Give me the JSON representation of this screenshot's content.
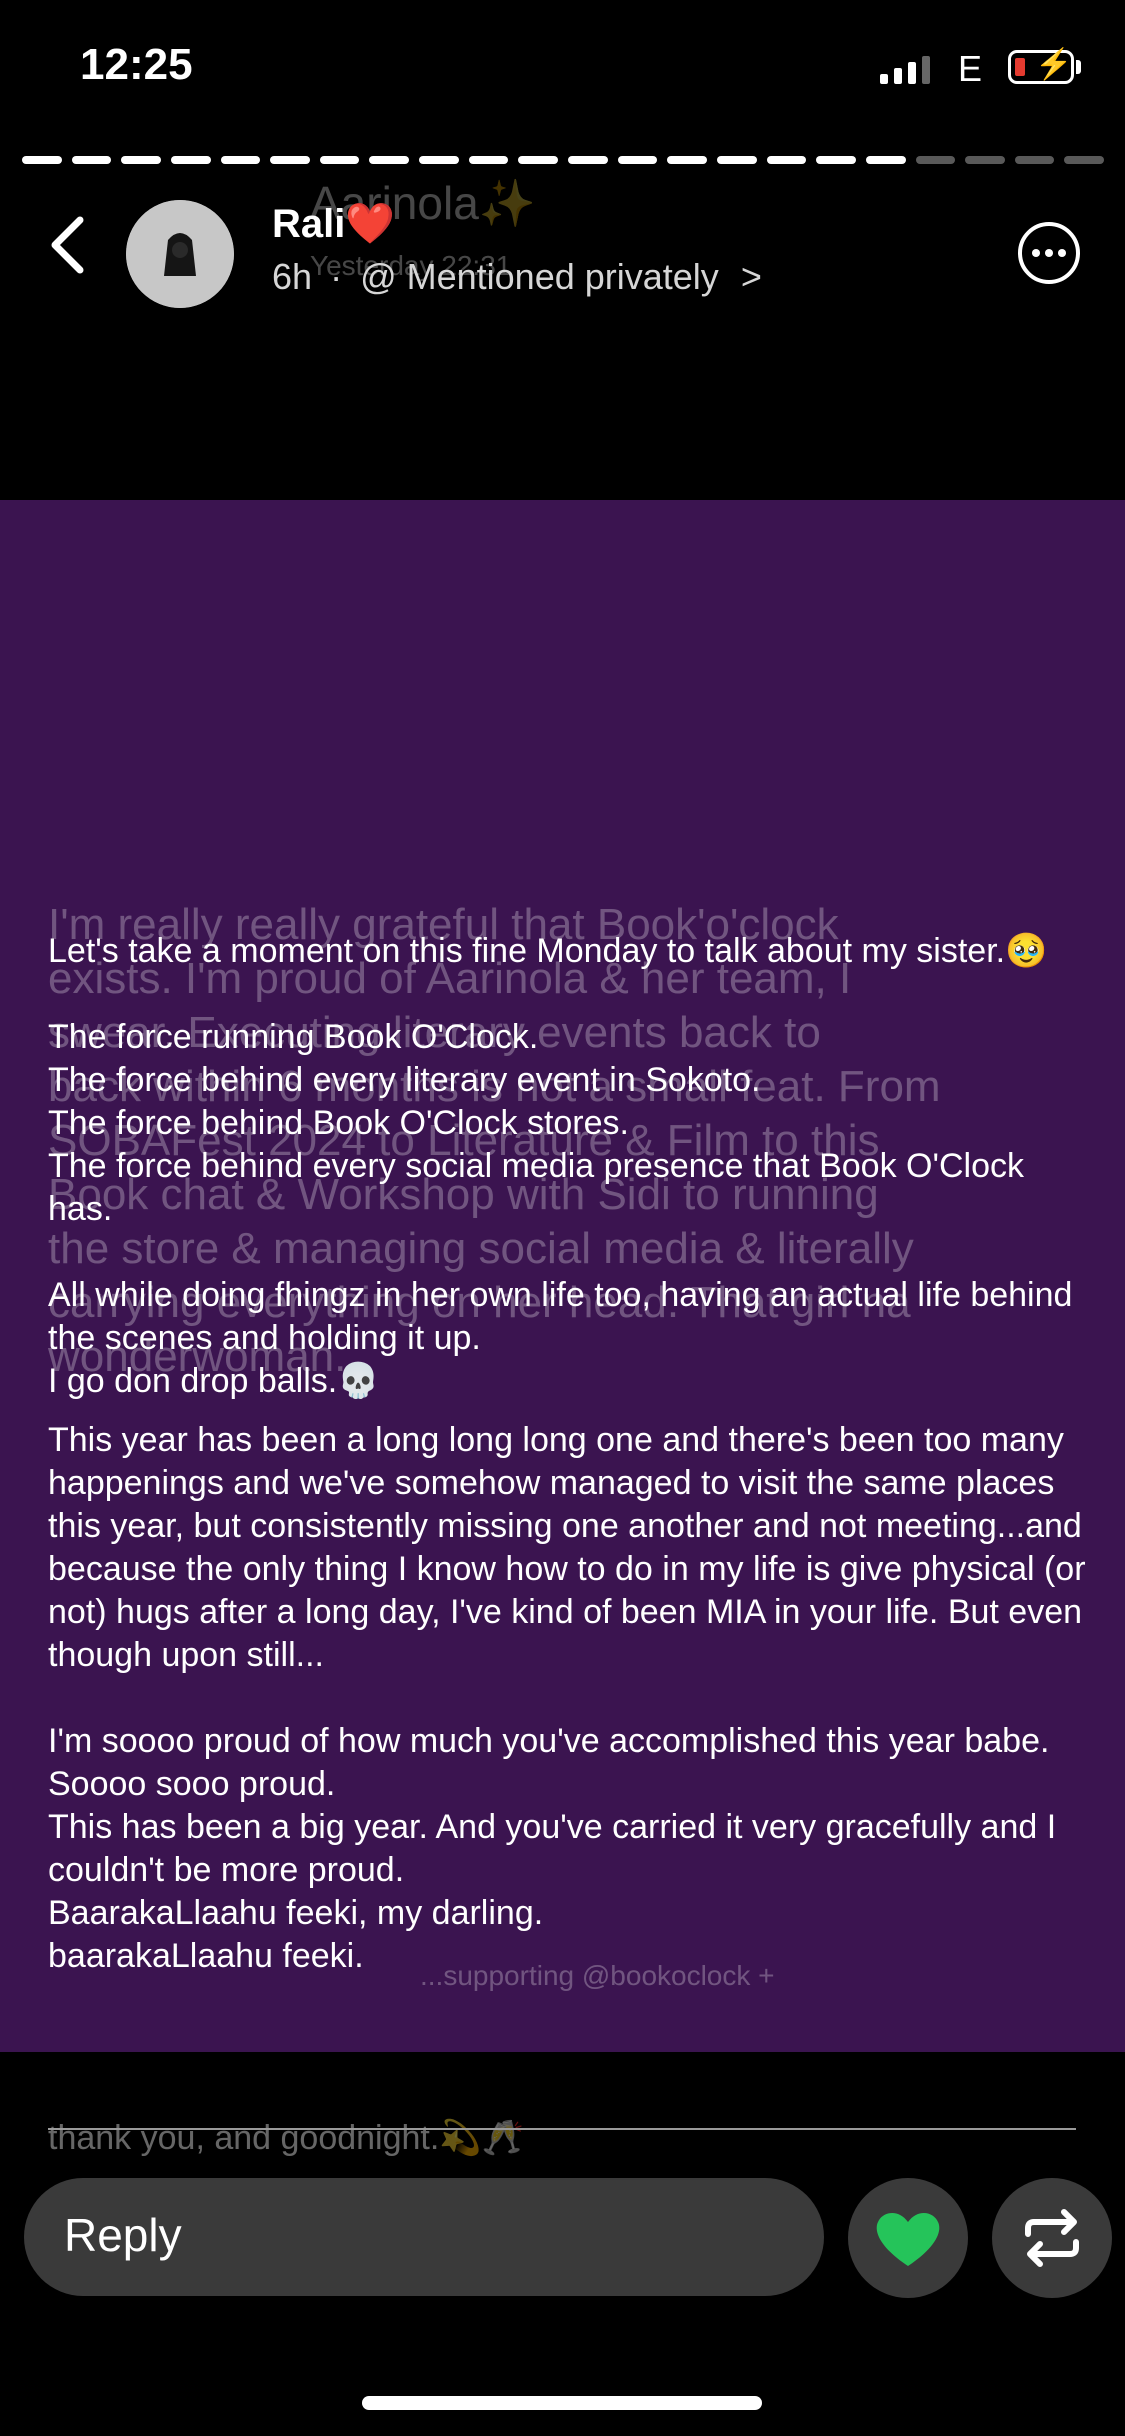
{
  "status_bar": {
    "time": "12:25",
    "network": "E",
    "battery_level": 0.1
  },
  "story": {
    "segments_total": 22,
    "segments_viewed": 18,
    "author": "Rali",
    "author_emoji": "❤️",
    "age": "6h",
    "mention_text": "@ Mentioned privately",
    "mention_chevron": ">",
    "paragraphs": [
      "Let's take a moment on this fine Monday to talk about my sister.🥹",
      "The force running Book O'Clock.\nThe force behind every literary event in Sokoto.\nThe force behind Book O'Clock stores.\nThe force behind every social media presence that Book O'Clock has.",
      "All while doing fhingz in her own life too, having an actual life behind the scenes and holding it up.\nI go don drop balls.💀",
      "This year has been a long long long one and there's been too many happenings and we've somehow managed to visit the same places this year, but consistently missing one another and not meeting...and because the only thing I know how to do in my life is give physical (or not) hugs after a long day, I've kind of been MIA in your life. But even though upon still...",
      "I'm soooo proud of how much you've accomplished this year babe. Soooo sooo proud.\nThis has been a big year. And you've carried it very gracefully and I couldn't be more proud.\nBaarakaLlaahu feeki, my darling.\nbaarakaLlaahu feeki."
    ]
  },
  "background_ghost": {
    "title": "Aarinola✨",
    "subtitle": "Yesterday 22:31",
    "lines": [
      "I'm really really grateful that Book'o'clock",
      "exists. I'm proud of Aarinola & her team, I",
      "swear. Executing literary events back to",
      "back within 6 months is not a small feat. From",
      "SOBAFest 2024 to Literature & Film to this",
      "Book chat & Workshop with Sidi to running",
      "the store & managing social media & literally",
      "carrying everything on her head. That girl na",
      "wonderwoman."
    ],
    "footer": "thank you, and goodnight.💫🥂",
    "mention": "...supporting @bookoclock +"
  },
  "reply_bar": {
    "placeholder": "Reply"
  },
  "colors": {
    "story_background": "#3b1450",
    "like_icon": "#25c45a",
    "input_background": "#3a3a3a"
  },
  "icons": {
    "back": "back-chevron-icon",
    "avatar": "avatar-silhouette-icon",
    "more": "more-options-icon",
    "like": "heart-icon",
    "repost": "repost-icon"
  }
}
